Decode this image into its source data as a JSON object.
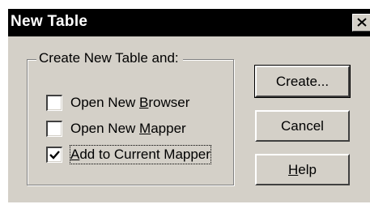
{
  "window": {
    "title": "New Table"
  },
  "group": {
    "label": "Create New Table and:"
  },
  "options": [
    {
      "pre": "Open New ",
      "mnemonic": "B",
      "post": "rowser",
      "checked": false
    },
    {
      "pre": "Open New ",
      "mnemonic": "M",
      "post": "apper",
      "checked": false
    },
    {
      "pre": "",
      "mnemonic": "A",
      "post": "dd to Current Mapper",
      "checked": true
    }
  ],
  "buttons": {
    "create": "Create...",
    "cancel": "Cancel",
    "help_mnemonic": "H",
    "help_rest": "elp"
  },
  "colors": {
    "face": "#d4d0c8",
    "titlebar": "#000000"
  }
}
